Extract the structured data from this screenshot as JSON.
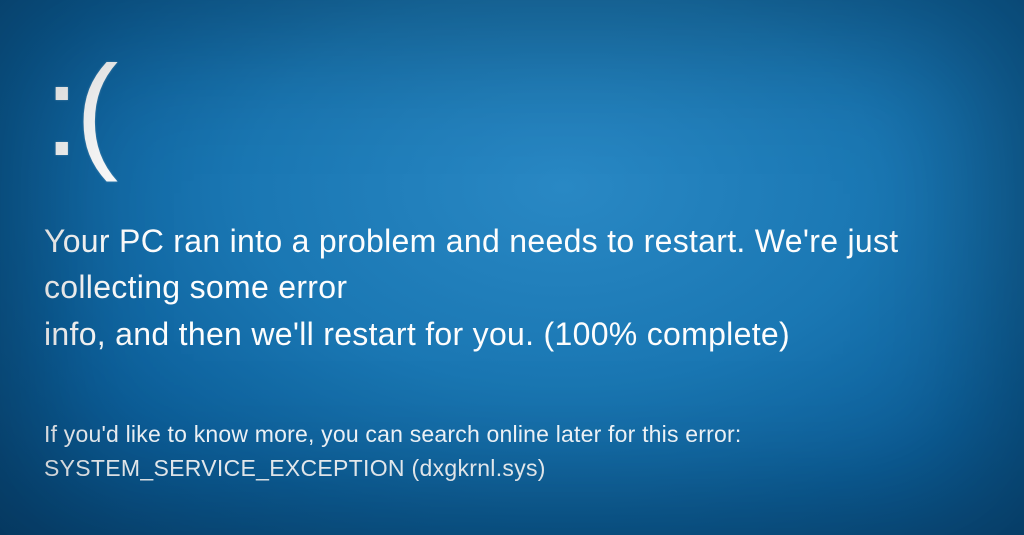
{
  "face": ":(",
  "message_line1": "Your PC ran into a problem and needs to restart. We're just collecting some error",
  "message_line2_prefix": "info, and then we'll restart for you. (",
  "progress_percent": "100%",
  "message_line2_suffix": " complete)",
  "detail_line": "If you'd like to know more, you can search online later for this error:",
  "error_code": "SYSTEM_SERVICE_EXCEPTION (dxgkrnl.sys)",
  "colors": {
    "background_inner": "#2988c4",
    "background_outer": "#074a7e",
    "text": "#ffffff"
  }
}
